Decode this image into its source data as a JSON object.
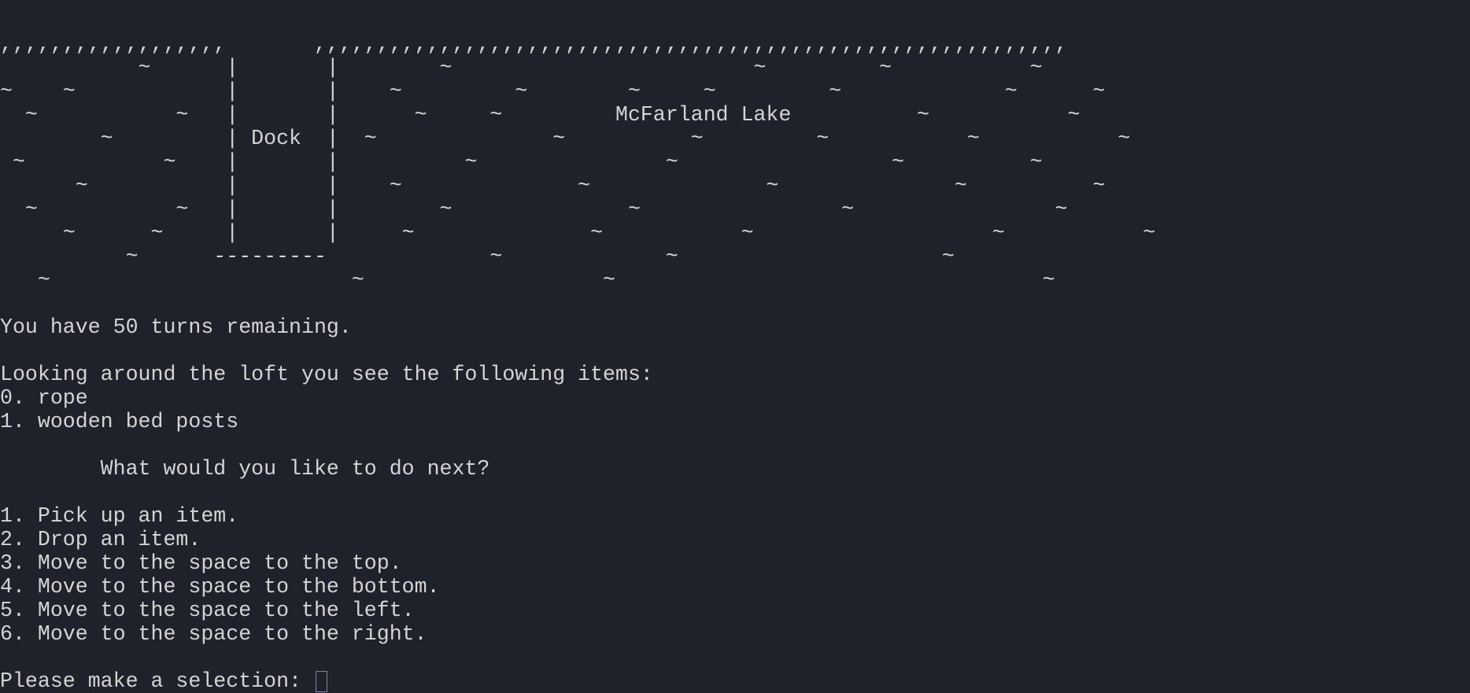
{
  "map": {
    "lines": [
      ",,,,,,,,,,,,,,,,,,       ,,,,,,,,,,,,,,,,,,,,,,,,,,,,,,,,,,,,,,,,,,,,,,,,,,,,,,,,,,,,",
      "           ~      |       |        ~                        ~         ~           ~",
      "~    ~            |       |    ~         ~        ~     ~         ~             ~      ~",
      "  ~           ~   |       |      ~     ~         McFarland Lake          ~           ~",
      "        ~         | Dock  |  ~              ~          ~         ~           ~           ~",
      " ~           ~    |       |          ~               ~                 ~          ~",
      "      ~           |       |    ~              ~              ~              ~          ~",
      "  ~           ~   |       |        ~              ~                ~                ~",
      "     ~      ~     |       |     ~              ~           ~                   ~           ~",
      "          ~      ---------             ~             ~                     ~",
      "   ~                        ~                   ~                                  ~"
    ]
  },
  "status": {
    "turns": "You have 50 turns remaining."
  },
  "items": {
    "header": "Looking around the loft you see the following items:",
    "list": [
      "0. rope",
      "1. wooden bed posts"
    ]
  },
  "menu": {
    "question": "        What would you like to do next?",
    "options": [
      "1. Pick up an item.",
      "2. Drop an item.",
      "3. Move to the space to the top.",
      "4. Move to the space to the bottom.",
      "5. Move to the space to the left.",
      "6. Move to the space to the right."
    ]
  },
  "prompt": {
    "label": "Please make a selection: ",
    "input_value": ""
  },
  "colors": {
    "background": "#1f222a",
    "foreground": "#d4d4d4",
    "cursor_border": "#7d86a8"
  }
}
